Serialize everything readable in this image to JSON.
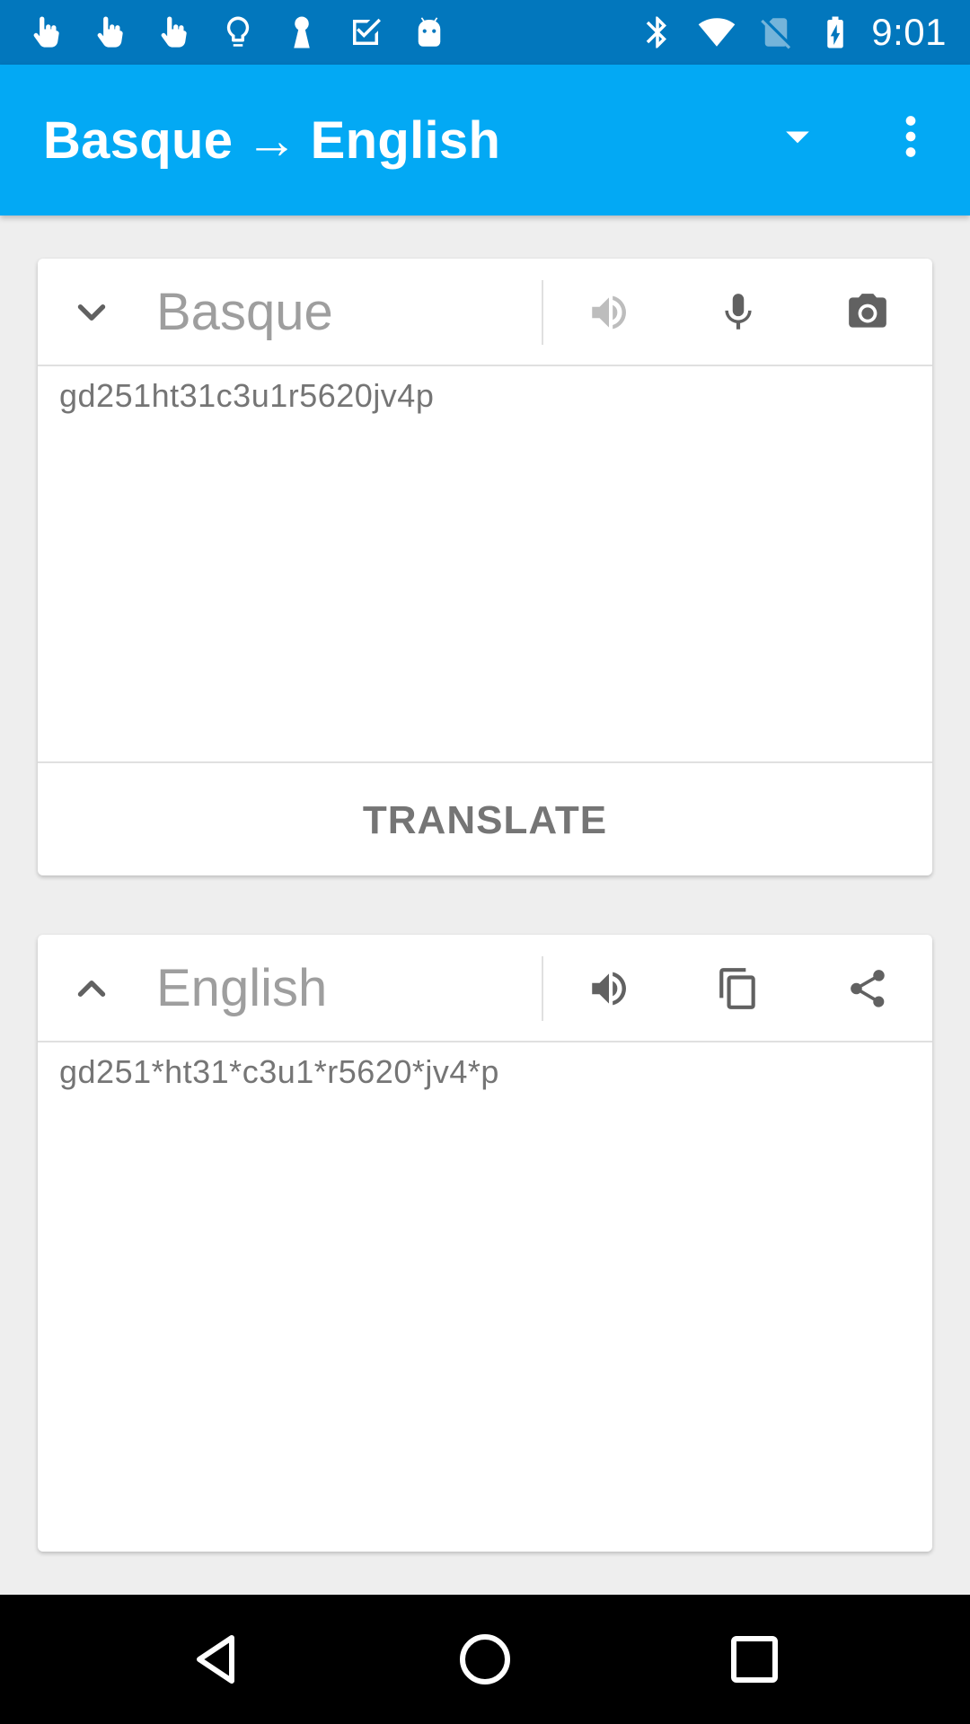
{
  "status_bar": {
    "time": "9:01",
    "left_icons": [
      "touch-icon",
      "touch-icon",
      "touch-icon",
      "lightbulb-icon",
      "keyhole-icon",
      "checkbox-check-icon",
      "android-icon"
    ],
    "right_icons": [
      "bluetooth-icon",
      "wifi-icon",
      "no-sim-icon",
      "battery-charging-icon"
    ]
  },
  "app_bar": {
    "source_lang": "Basque",
    "arrow": "→",
    "target_lang": "English",
    "color": "#03a9f4",
    "status_color": "#0277bd"
  },
  "source_card": {
    "language": "Basque",
    "input_text": "gd251ht31c3u1r5620jv4p",
    "translate_label": "TRANSLATE",
    "icons": [
      "chevron-down-icon",
      "speaker-icon",
      "microphone-icon",
      "camera-icon"
    ]
  },
  "target_card": {
    "language": "English",
    "output_text": "gd251*ht31*c3u1*r5620*jv4*p",
    "icons": [
      "chevron-up-icon",
      "speaker-icon",
      "copy-icon",
      "share-icon"
    ]
  },
  "nav_bar": {
    "icons": [
      "back-icon",
      "home-icon",
      "recent-apps-icon"
    ]
  }
}
